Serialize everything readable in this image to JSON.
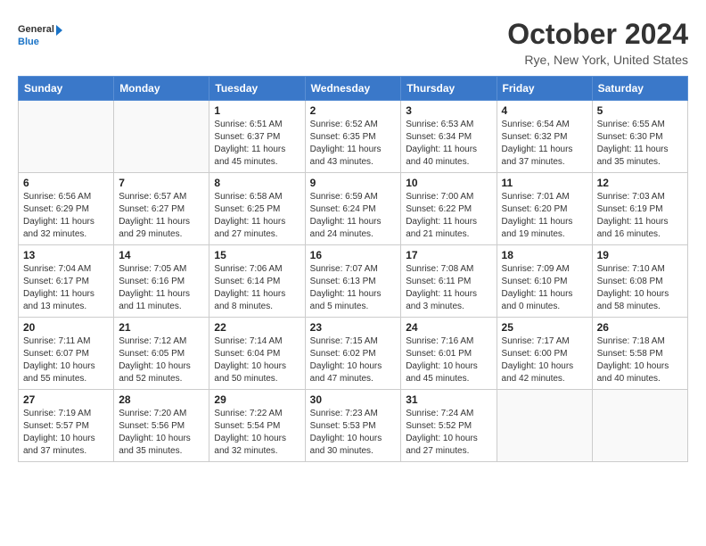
{
  "logo": {
    "general": "General",
    "blue": "Blue"
  },
  "title": "October 2024",
  "subtitle": "Rye, New York, United States",
  "headers": [
    "Sunday",
    "Monday",
    "Tuesday",
    "Wednesday",
    "Thursday",
    "Friday",
    "Saturday"
  ],
  "weeks": [
    [
      {
        "day": "",
        "sunrise": "",
        "sunset": "",
        "daylight": "",
        "empty": true
      },
      {
        "day": "",
        "sunrise": "",
        "sunset": "",
        "daylight": "",
        "empty": true
      },
      {
        "day": "1",
        "sunrise": "Sunrise: 6:51 AM",
        "sunset": "Sunset: 6:37 PM",
        "daylight": "Daylight: 11 hours and 45 minutes.",
        "empty": false
      },
      {
        "day": "2",
        "sunrise": "Sunrise: 6:52 AM",
        "sunset": "Sunset: 6:35 PM",
        "daylight": "Daylight: 11 hours and 43 minutes.",
        "empty": false
      },
      {
        "day": "3",
        "sunrise": "Sunrise: 6:53 AM",
        "sunset": "Sunset: 6:34 PM",
        "daylight": "Daylight: 11 hours and 40 minutes.",
        "empty": false
      },
      {
        "day": "4",
        "sunrise": "Sunrise: 6:54 AM",
        "sunset": "Sunset: 6:32 PM",
        "daylight": "Daylight: 11 hours and 37 minutes.",
        "empty": false
      },
      {
        "day": "5",
        "sunrise": "Sunrise: 6:55 AM",
        "sunset": "Sunset: 6:30 PM",
        "daylight": "Daylight: 11 hours and 35 minutes.",
        "empty": false
      }
    ],
    [
      {
        "day": "6",
        "sunrise": "Sunrise: 6:56 AM",
        "sunset": "Sunset: 6:29 PM",
        "daylight": "Daylight: 11 hours and 32 minutes.",
        "empty": false
      },
      {
        "day": "7",
        "sunrise": "Sunrise: 6:57 AM",
        "sunset": "Sunset: 6:27 PM",
        "daylight": "Daylight: 11 hours and 29 minutes.",
        "empty": false
      },
      {
        "day": "8",
        "sunrise": "Sunrise: 6:58 AM",
        "sunset": "Sunset: 6:25 PM",
        "daylight": "Daylight: 11 hours and 27 minutes.",
        "empty": false
      },
      {
        "day": "9",
        "sunrise": "Sunrise: 6:59 AM",
        "sunset": "Sunset: 6:24 PM",
        "daylight": "Daylight: 11 hours and 24 minutes.",
        "empty": false
      },
      {
        "day": "10",
        "sunrise": "Sunrise: 7:00 AM",
        "sunset": "Sunset: 6:22 PM",
        "daylight": "Daylight: 11 hours and 21 minutes.",
        "empty": false
      },
      {
        "day": "11",
        "sunrise": "Sunrise: 7:01 AM",
        "sunset": "Sunset: 6:20 PM",
        "daylight": "Daylight: 11 hours and 19 minutes.",
        "empty": false
      },
      {
        "day": "12",
        "sunrise": "Sunrise: 7:03 AM",
        "sunset": "Sunset: 6:19 PM",
        "daylight": "Daylight: 11 hours and 16 minutes.",
        "empty": false
      }
    ],
    [
      {
        "day": "13",
        "sunrise": "Sunrise: 7:04 AM",
        "sunset": "Sunset: 6:17 PM",
        "daylight": "Daylight: 11 hours and 13 minutes.",
        "empty": false
      },
      {
        "day": "14",
        "sunrise": "Sunrise: 7:05 AM",
        "sunset": "Sunset: 6:16 PM",
        "daylight": "Daylight: 11 hours and 11 minutes.",
        "empty": false
      },
      {
        "day": "15",
        "sunrise": "Sunrise: 7:06 AM",
        "sunset": "Sunset: 6:14 PM",
        "daylight": "Daylight: 11 hours and 8 minutes.",
        "empty": false
      },
      {
        "day": "16",
        "sunrise": "Sunrise: 7:07 AM",
        "sunset": "Sunset: 6:13 PM",
        "daylight": "Daylight: 11 hours and 5 minutes.",
        "empty": false
      },
      {
        "day": "17",
        "sunrise": "Sunrise: 7:08 AM",
        "sunset": "Sunset: 6:11 PM",
        "daylight": "Daylight: 11 hours and 3 minutes.",
        "empty": false
      },
      {
        "day": "18",
        "sunrise": "Sunrise: 7:09 AM",
        "sunset": "Sunset: 6:10 PM",
        "daylight": "Daylight: 11 hours and 0 minutes.",
        "empty": false
      },
      {
        "day": "19",
        "sunrise": "Sunrise: 7:10 AM",
        "sunset": "Sunset: 6:08 PM",
        "daylight": "Daylight: 10 hours and 58 minutes.",
        "empty": false
      }
    ],
    [
      {
        "day": "20",
        "sunrise": "Sunrise: 7:11 AM",
        "sunset": "Sunset: 6:07 PM",
        "daylight": "Daylight: 10 hours and 55 minutes.",
        "empty": false
      },
      {
        "day": "21",
        "sunrise": "Sunrise: 7:12 AM",
        "sunset": "Sunset: 6:05 PM",
        "daylight": "Daylight: 10 hours and 52 minutes.",
        "empty": false
      },
      {
        "day": "22",
        "sunrise": "Sunrise: 7:14 AM",
        "sunset": "Sunset: 6:04 PM",
        "daylight": "Daylight: 10 hours and 50 minutes.",
        "empty": false
      },
      {
        "day": "23",
        "sunrise": "Sunrise: 7:15 AM",
        "sunset": "Sunset: 6:02 PM",
        "daylight": "Daylight: 10 hours and 47 minutes.",
        "empty": false
      },
      {
        "day": "24",
        "sunrise": "Sunrise: 7:16 AM",
        "sunset": "Sunset: 6:01 PM",
        "daylight": "Daylight: 10 hours and 45 minutes.",
        "empty": false
      },
      {
        "day": "25",
        "sunrise": "Sunrise: 7:17 AM",
        "sunset": "Sunset: 6:00 PM",
        "daylight": "Daylight: 10 hours and 42 minutes.",
        "empty": false
      },
      {
        "day": "26",
        "sunrise": "Sunrise: 7:18 AM",
        "sunset": "Sunset: 5:58 PM",
        "daylight": "Daylight: 10 hours and 40 minutes.",
        "empty": false
      }
    ],
    [
      {
        "day": "27",
        "sunrise": "Sunrise: 7:19 AM",
        "sunset": "Sunset: 5:57 PM",
        "daylight": "Daylight: 10 hours and 37 minutes.",
        "empty": false
      },
      {
        "day": "28",
        "sunrise": "Sunrise: 7:20 AM",
        "sunset": "Sunset: 5:56 PM",
        "daylight": "Daylight: 10 hours and 35 minutes.",
        "empty": false
      },
      {
        "day": "29",
        "sunrise": "Sunrise: 7:22 AM",
        "sunset": "Sunset: 5:54 PM",
        "daylight": "Daylight: 10 hours and 32 minutes.",
        "empty": false
      },
      {
        "day": "30",
        "sunrise": "Sunrise: 7:23 AM",
        "sunset": "Sunset: 5:53 PM",
        "daylight": "Daylight: 10 hours and 30 minutes.",
        "empty": false
      },
      {
        "day": "31",
        "sunrise": "Sunrise: 7:24 AM",
        "sunset": "Sunset: 5:52 PM",
        "daylight": "Daylight: 10 hours and 27 minutes.",
        "empty": false
      },
      {
        "day": "",
        "sunrise": "",
        "sunset": "",
        "daylight": "",
        "empty": true
      },
      {
        "day": "",
        "sunrise": "",
        "sunset": "",
        "daylight": "",
        "empty": true
      }
    ]
  ]
}
